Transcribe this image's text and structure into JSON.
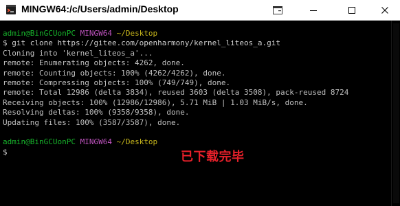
{
  "window": {
    "title": "MINGW64:/c/Users/admin/Desktop",
    "icon": "git-bash-icon"
  },
  "controls": {
    "menu_icon": "terminal-menu-icon",
    "minimize_icon": "minimize-icon",
    "maximize_icon": "maximize-icon",
    "close_icon": "close-icon"
  },
  "colors": {
    "prompt_user": "#17b32b",
    "prompt_env": "#c154c1",
    "prompt_path": "#c8b71c",
    "annotation": "#e8202a"
  },
  "terminal": {
    "prompt1": {
      "user": "admin@BinGCUonPC",
      "env": "MINGW64",
      "path": "~/Desktop"
    },
    "command": "$ git clone https://gitee.com/openharmony/kernel_liteos_a.git",
    "output": [
      "Cloning into 'kernel_liteos_a'...",
      "remote: Enumerating objects: 4262, done.",
      "remote: Counting objects: 100% (4262/4262), done.",
      "remote: Compressing objects: 100% (749/749), done.",
      "remote: Total 12986 (delta 3834), reused 3603 (delta 3508), pack-reused 8724",
      "Receiving objects: 100% (12986/12986), 5.71 MiB | 1.03 MiB/s, done.",
      "Resolving deltas: 100% (9358/9358), done.",
      "Updating files: 100% (3587/3587), done."
    ],
    "prompt2": {
      "user": "admin@BinGCUonPC",
      "env": "MINGW64",
      "path": "~/Desktop"
    },
    "cursor_line": "$"
  },
  "annotation": {
    "text": "已下载完毕"
  }
}
